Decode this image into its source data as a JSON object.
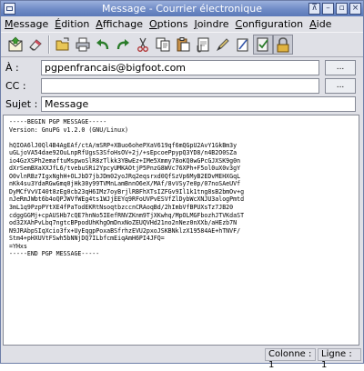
{
  "window": {
    "title": "Message - Courrier électronique"
  },
  "menubar": {
    "items": [
      {
        "label": "Message",
        "accel": "M"
      },
      {
        "label": "Édition",
        "accel": "É"
      },
      {
        "label": "Affichage",
        "accel": "A"
      },
      {
        "label": "Options",
        "accel": "O"
      },
      {
        "label": "Joindre",
        "accel": "J"
      },
      {
        "label": "Configuration",
        "accel": "C"
      },
      {
        "label": "Aide",
        "accel": "A"
      }
    ]
  },
  "toolbar": {
    "icons": [
      "send-icon",
      "eraser-icon",
      "open-icon",
      "print-icon",
      "undo-icon",
      "redo-icon",
      "cut-icon",
      "copy-icon",
      "paste-icon",
      "attach-icon",
      "pen-icon",
      "edit-icon",
      "spell-check-icon",
      "lock-icon"
    ]
  },
  "fields": {
    "to": {
      "label": "À :",
      "value": "pgpenfrancais@bigfoot.com",
      "button": "..."
    },
    "cc": {
      "label": "CC :",
      "value": "",
      "button": "..."
    },
    "subject": {
      "label": "Sujet :",
      "value": "Message"
    }
  },
  "message": {
    "lines": [
      "-----BEGIN PGP MESSAGE-----",
      "Version: GnuPG v1.2.0 (GNU/Linux)",
      "",
      "hQIOA6lJ0Ql4B4AgEAf/ctA/mSRP+XBuo6ohePXaV619qf6mQGpU2AvY1GkBm3y",
      "uGLjoVA54dae92OuLnpRfUgsS3SfoHsOV+2j/+sEpcoePpypQ3YD8/n4B2O0SZa",
      "io4GzXSPh2emaftuMspwoSlR8zTlkk3YBwEz+IMe5Xmmy78oKQ0wGPcGJXSK9g0n",
      "dXrSemBXaXXJfL6/tvebuSRi2YpcyUMKAOtjP5PnzG8WVc76XPh+F5ol0uX0v3gY",
      "O0vlnRBz7IgxNghH+OLJbD7jbJDm02yoJRq2eqsrxd0QfSzVp6MyB2EDvMEHXGqL",
      "nKk4su3YdaRGwGmq0jHk30y99TVMnLamBnnO6eX/MAf/8vVSy7e0p/07noSAeUVf",
      "DyMCfVvVI40t8zEg0cb23qH6IMz7oyBrjlRBFhXTsIZFGv9Il1k1tng8sB2bmOv+g",
      "nJeRmJWbt6b4oQPJWVfWEg4ts1WJjEEYq9RFoUVPvESVfZlDybWcXNJU3alogPmtd",
      "3mL1q9PzpPYtXE4fPaTodEKRtNsoqtbzccnCRAoqBd/2hImbVfBPUXsTz7JB20",
      "cdggGGMj+cpAUSHb7cQE7hnNo5IEefRNVZKnm9TjXKwhq/MpOLMGFbozhJTVKdaST",
      "od32XAhPvLbq7ngtcBPpodUhKhgOmDnxNoZEUQVHd21no2nNez0nXXb/aHEzb7N",
      "N9JRAbpSIqXcio3fx+UyEqgpPoxaBSfrhzEVU2pxoJSKBNklzX19584AE+hTNVF/",
      "Stm4+pHXUVtFSwh5bNNjDQ7ILbfcmEiqAmH6PI4JFQ=",
      "=YHxs",
      "-----END PGP MESSAGE-----"
    ]
  },
  "status": {
    "column": "Colonne : 1",
    "line": "Ligne : 1"
  }
}
